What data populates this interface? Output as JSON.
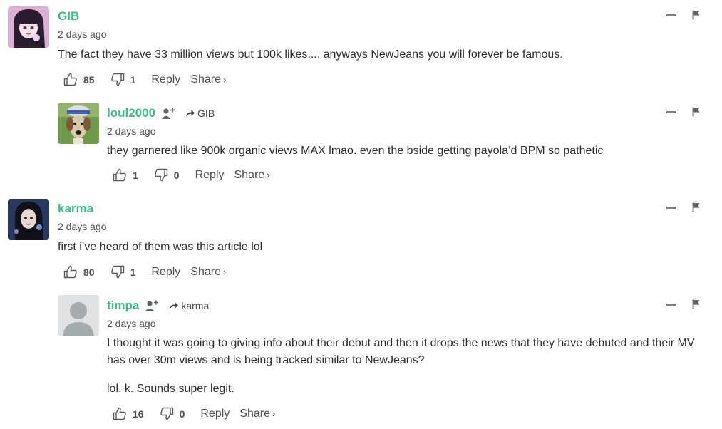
{
  "comments": [
    {
      "author": "GIB",
      "time": "2 days ago",
      "text": [
        "The fact they have 33 million views but 100k likes.... anyways NewJeans you will forever be famous."
      ],
      "upvotes": "85",
      "downvotes": "1",
      "reply_label": "Reply",
      "share_label": "Share",
      "avatar_icon": "anime-girl-avatar"
    },
    {
      "author": "loul2000",
      "reply_to": "GIB",
      "time": "2 days ago",
      "text": [
        "they garnered like 900k organic views MAX lmao. even the bside getting payola’d BPM so pathetic"
      ],
      "upvotes": "1",
      "downvotes": "0",
      "reply_label": "Reply",
      "share_label": "Share",
      "avatar_icon": "dog-with-hat-avatar"
    },
    {
      "author": "karma",
      "time": "2 days ago",
      "text": [
        "first i’ve heard of them was this article lol"
      ],
      "upvotes": "80",
      "downvotes": "1",
      "reply_label": "Reply",
      "share_label": "Share",
      "avatar_icon": "girl-portrait-avatar"
    },
    {
      "author": "timpa",
      "reply_to": "karma",
      "time": "2 days ago",
      "text": [
        "I thought it was going to giving info about their debut and then it drops the news that they have debuted and their MV has over 30m views and is being tracked similar to NewJeans?",
        "lol. k. Sounds super legit."
      ],
      "upvotes": "16",
      "downvotes": "0",
      "reply_label": "Reply",
      "share_label": "Share",
      "avatar_icon": "default-user-avatar"
    }
  ],
  "colors": {
    "author": "#3dbc8a",
    "text": "#2a2e2e",
    "muted": "#4a4f50",
    "icon": "#7c8283"
  }
}
